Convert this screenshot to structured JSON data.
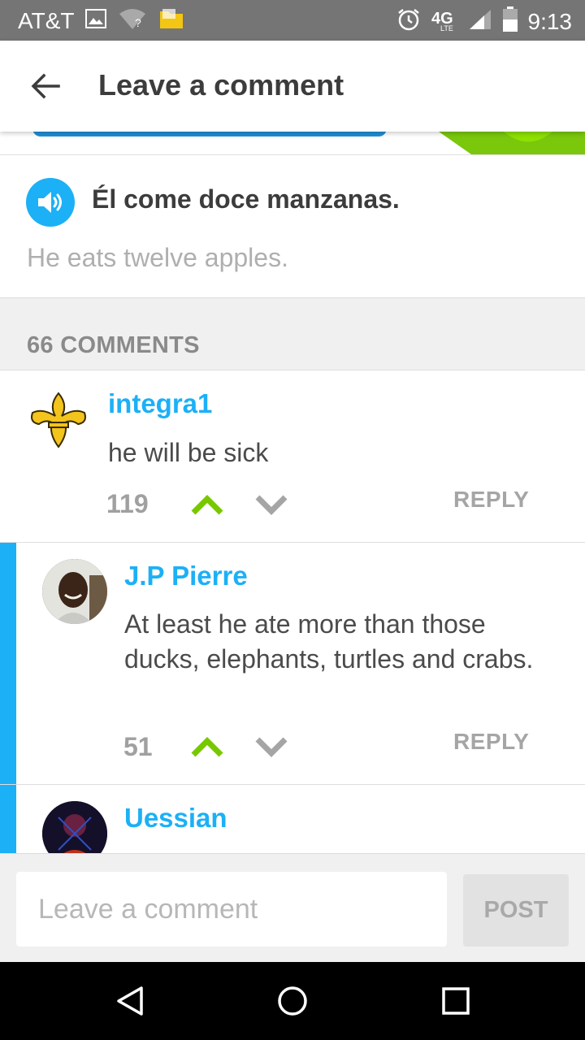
{
  "status_bar": {
    "carrier": "AT&T",
    "time": "9:13",
    "network": "4G",
    "icons": [
      "image-icon",
      "wifi-question-icon",
      "folder-icon",
      "alarm-icon",
      "4g-lte-icon",
      "signal-icon",
      "battery-icon"
    ]
  },
  "app_bar": {
    "title": "Leave a comment",
    "back_icon": "arrow-back-icon"
  },
  "sentence": {
    "text": "Él come doce manzanas.",
    "translation": "He eats twelve apples.",
    "speaker_icon": "speaker-icon"
  },
  "comments_header": "66 COMMENTS",
  "comments": [
    {
      "username": "integra1",
      "text": "he will be sick",
      "votes": "119",
      "reply_label": "REPLY",
      "avatar": "fleur-de-lis-avatar"
    },
    {
      "username": "J.P Pierre",
      "text": "At least he ate more than those ducks, elephants, turtles and crabs.",
      "votes": "51",
      "reply_label": "REPLY",
      "avatar": "photo-avatar"
    },
    {
      "username": "Uessian",
      "avatar": "photo-avatar"
    }
  ],
  "composer": {
    "placeholder": "Leave a comment",
    "value": "",
    "post_label": "POST"
  },
  "colors": {
    "accent_blue": "#1cb0f6",
    "upvote_green": "#78c800",
    "status_bar": "#757575"
  }
}
